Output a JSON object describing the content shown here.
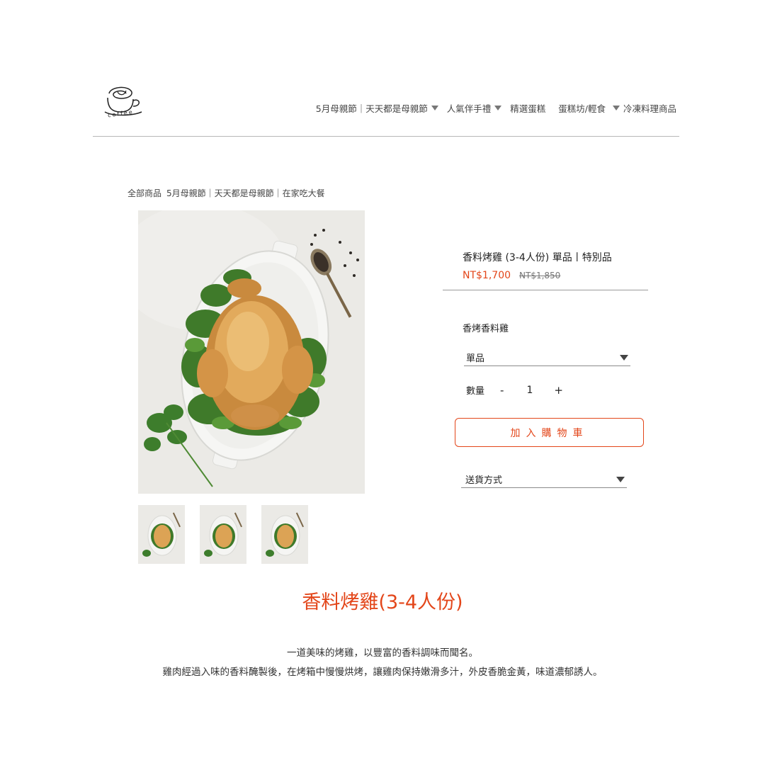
{
  "brand": {
    "logo_text": "coffee"
  },
  "nav": {
    "items": [
      {
        "label": "5月母親節｜天天都是母親節",
        "has_dropdown": true
      },
      {
        "label": "人氣伴手禮",
        "has_dropdown": true
      },
      {
        "label": "精選蛋糕",
        "has_dropdown": false
      },
      {
        "label": "蛋糕坊/輕食",
        "has_dropdown": true
      },
      {
        "label": "冷凍料理商品",
        "has_dropdown": false
      }
    ]
  },
  "breadcrumb": [
    "全部商品",
    "5月母親節｜天天都是母親節｜在家吃大餐"
  ],
  "product": {
    "title": "香料烤雞 (3-4人份) 單品丨特別品",
    "price": "NT$1,700",
    "original_price": "NT$1,850",
    "variant_label": "香烤香料雞",
    "variant_selected": "單品",
    "quantity_label": "數量",
    "quantity_minus": "-",
    "quantity_value": "1",
    "quantity_plus": "+",
    "add_to_cart": "加入購物車",
    "shipping_selected": "送貨方式",
    "thumbnail_count": 3
  },
  "description": {
    "title": "香料烤雞(3-4人份)",
    "line1": "一道美味的烤雞，以豐富的香料調味而聞名。",
    "line2": "雞肉經過入味的香料醃製後，在烤箱中慢慢烘烤，讓雞肉保持嫩滑多汁，外皮香脆金黃，味道濃郁誘人。"
  },
  "colors": {
    "accent": "#e3461a",
    "rule": "#b8b8b8",
    "text": "#333333"
  }
}
